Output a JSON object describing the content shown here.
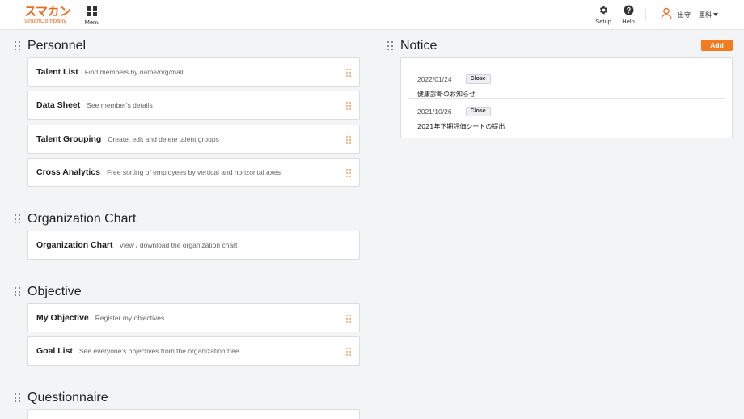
{
  "header": {
    "logo_jp": "スマカン",
    "logo_en": "SmartCompany",
    "menu_label": "Menu",
    "setup_label": "Setup",
    "help_label": "Help",
    "user_name": "出守",
    "user_dept": "亜科",
    "brand_color": "#f06a1e"
  },
  "sections": {
    "personnel": {
      "title": "Personnel",
      "cards": [
        {
          "title": "Talent List",
          "desc": "Find members by name/org/mail"
        },
        {
          "title": "Data Sheet",
          "desc": "See member's details"
        },
        {
          "title": "Talent Grouping",
          "desc": "Create, edit and delete talent groups"
        },
        {
          "title": "Cross Analytics",
          "desc": "Free sorting of employees by vertical and horizontal axes"
        }
      ]
    },
    "org_chart": {
      "title": "Organization Chart",
      "cards": [
        {
          "title": "Organization Chart",
          "desc": "View / download the organization chart"
        }
      ]
    },
    "objective": {
      "title": "Objective",
      "cards": [
        {
          "title": "My Objective",
          "desc": "Register my objectives"
        },
        {
          "title": "Goal List",
          "desc": "See everyone's objectives from the organization tree"
        }
      ]
    },
    "questionnaire": {
      "title": "Questionnaire"
    }
  },
  "notice": {
    "title": "Notice",
    "add_label": "Add",
    "accent_color": "#f47b20",
    "items": [
      {
        "date": "2022/01/24",
        "close_label": "Close",
        "text": "健康診断のお知らせ"
      },
      {
        "date": "2021/10/26",
        "close_label": "Close",
        "text": "2021年下期評価シートの提出"
      }
    ]
  }
}
